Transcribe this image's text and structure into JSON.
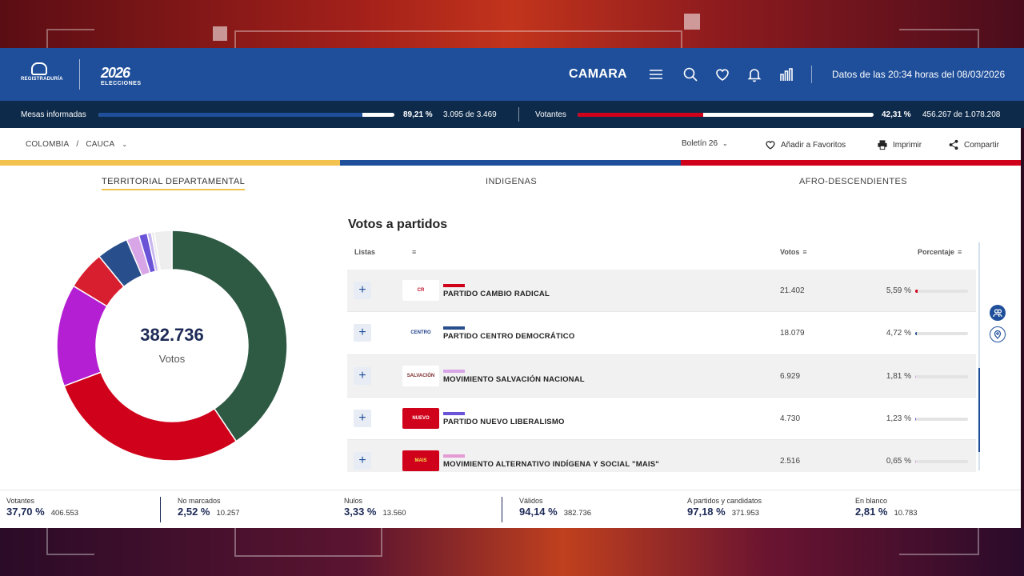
{
  "header": {
    "registry_logo_text": "REGISTRADURÍA",
    "elections_logo_year": "2026",
    "elections_logo_word": "ELECCIONES",
    "title": "CAMARA",
    "icons": [
      "menu-icon",
      "search-icon",
      "heart-icon",
      "bell-icon",
      "bar-chart-icon"
    ],
    "date_text": "Datos de las 20:34 horas del 08/03/2026"
  },
  "progress": {
    "mesas": {
      "label": "Mesas informadas",
      "percent_text": "89,21 %",
      "count_text": "3.095 de 3.469",
      "fraction": 0.8921,
      "color": "#1f4f9a"
    },
    "votantes": {
      "label": "Votantes",
      "percent_text": "42,31 %",
      "count_text": "456.267 de 1.078.208",
      "fraction": 0.4231,
      "color": "#d0021b"
    }
  },
  "breadcrumb": {
    "country": "COLOMBIA",
    "separator": "/",
    "department": "CAUCA"
  },
  "toolbar": {
    "bulletin": "Boletín 26",
    "favorites": "Añadir a Favoritos",
    "print": "Imprimir",
    "share": "Compartir"
  },
  "colors": {
    "yellow": "#f2c14e",
    "blue": "#1f4f9a",
    "red": "#d0021b",
    "navy": "#1d2a56"
  },
  "tabs": [
    {
      "label": "TERRITORIAL DEPARTAMENTAL",
      "active": true
    },
    {
      "label": "INDIGENAS",
      "active": false
    },
    {
      "label": "AFRO-DESCENDIENTES",
      "active": false
    }
  ],
  "donut": {
    "total": "382.736",
    "caption": "Votos",
    "slices": [
      {
        "value": 41,
        "color": "#2e5a44"
      },
      {
        "value": 29,
        "color": "#d0021b"
      },
      {
        "value": 14.5,
        "color": "#b41fd3"
      },
      {
        "value": 5.5,
        "color": "#d81f2f"
      },
      {
        "value": 4.5,
        "color": "#284f8c"
      },
      {
        "value": 1.8,
        "color": "#d8a6e6"
      },
      {
        "value": 1.2,
        "color": "#6b53d8"
      },
      {
        "value": 0.6,
        "color": "#c9b8f0"
      },
      {
        "value": 0.4,
        "color": "#e8e8e8"
      },
      {
        "value": 2.5,
        "color": "#eeeeee"
      }
    ]
  },
  "table": {
    "title": "Votos a partidos",
    "col_listas": "Listas",
    "col_votos": "Votos",
    "col_porcentaje": "Porcentaje",
    "sort_glyph": "≡",
    "rows": [
      {
        "name": "PARTIDO CAMBIO RADICAL",
        "votes": "21.402",
        "percent": "5,59 %",
        "pct": 5.59,
        "color": "#d0021b",
        "logo": "CR",
        "logo_bg": "#ffffff",
        "logo_fg": "#c0102a"
      },
      {
        "name": "PARTIDO CENTRO DEMOCRÁTICO",
        "votes": "18.079",
        "percent": "4,72 %",
        "pct": 4.72,
        "color": "#284f8c",
        "logo": "CENTRO",
        "logo_bg": "#ffffff",
        "logo_fg": "#1f3f8a"
      },
      {
        "name": "MOVIMIENTO SALVACIÓN NACIONAL",
        "votes": "6.929",
        "percent": "1,81 %",
        "pct": 1.81,
        "color": "#d8a6e6",
        "logo": "SALVACIÓN NACIONAL",
        "logo_bg": "#ffffff",
        "logo_fg": "#7a2a2a"
      },
      {
        "name": "PARTIDO NUEVO LIBERALISMO",
        "votes": "4.730",
        "percent": "1,23 %",
        "pct": 1.23,
        "color": "#6b53d8",
        "logo": "NUEVO LIBERALISMO",
        "logo_bg": "#d0021b",
        "logo_fg": "#ffffff"
      },
      {
        "name": "MOVIMIENTO ALTERNATIVO INDÍGENA Y SOCIAL \"MAIS\"",
        "votes": "2.516",
        "percent": "0,65 %",
        "pct": 0.65,
        "color": "#e59ad6",
        "logo": "MAIS",
        "logo_bg": "#d0021b",
        "logo_fg": "#f2e14e"
      }
    ]
  },
  "stats": [
    {
      "label": "Votantes",
      "percent": "37,70 %",
      "count": "406.553"
    },
    {
      "label": "No marcados",
      "percent": "2,52 %",
      "count": "10.257"
    },
    {
      "label": "Nulos",
      "percent": "3,33 %",
      "count": "13.560"
    },
    {
      "label": "Válidos",
      "percent": "94,14 %",
      "count": "382.736"
    },
    {
      "label": "A partidos y candidatos",
      "percent": "97,18 %",
      "count": "371.953"
    },
    {
      "label": "En blanco",
      "percent": "2,81 %",
      "count": "10.783"
    }
  ]
}
